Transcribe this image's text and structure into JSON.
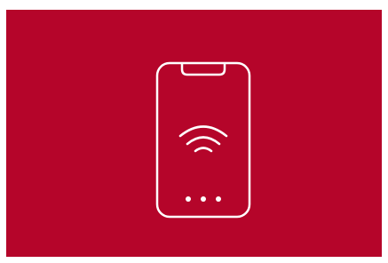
{
  "colors": {
    "background": "#b5052a",
    "page": "#ffffff",
    "stroke": "#ffffff"
  },
  "icons": {
    "device": "smartphone-icon",
    "signal": "wifi-signal-icon",
    "indicator": "more-dots-icon"
  }
}
